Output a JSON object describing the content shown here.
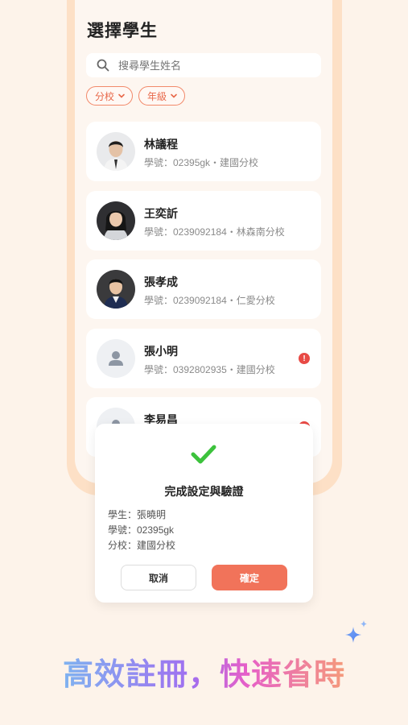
{
  "header": {
    "title": "選擇學生"
  },
  "search": {
    "placeholder": "搜尋學生姓名"
  },
  "filters": [
    {
      "label": "分校"
    },
    {
      "label": "年級"
    }
  ],
  "students": [
    {
      "name": "林議程",
      "meta": "學號：02395gk・建國分校",
      "avatar": "photo",
      "alert": false
    },
    {
      "name": "王奕訢",
      "meta": "學號：0239092184・林森南分校",
      "avatar": "photo",
      "alert": false
    },
    {
      "name": "張孝成",
      "meta": "學號：0239092184・仁愛分校",
      "avatar": "photo",
      "alert": false
    },
    {
      "name": "張小明",
      "meta": "學號：0392802935・建國分校",
      "avatar": "placeholder",
      "alert": true
    },
    {
      "name": "李易昌",
      "meta": "",
      "avatar": "placeholder",
      "alert": true
    }
  ],
  "dialog": {
    "title": "完成設定與驗證",
    "student_line": "學生：張曉明",
    "id_line": "學號：02395gk",
    "branch_line": "分校：建國分校",
    "cancel_label": "取消",
    "confirm_label": "確定"
  },
  "tagline": "高效註冊，快速省時",
  "colors": {
    "accent": "#f1735a",
    "check": "#3cc23c",
    "alert": "#e84a45",
    "background": "#fdf3ea"
  }
}
